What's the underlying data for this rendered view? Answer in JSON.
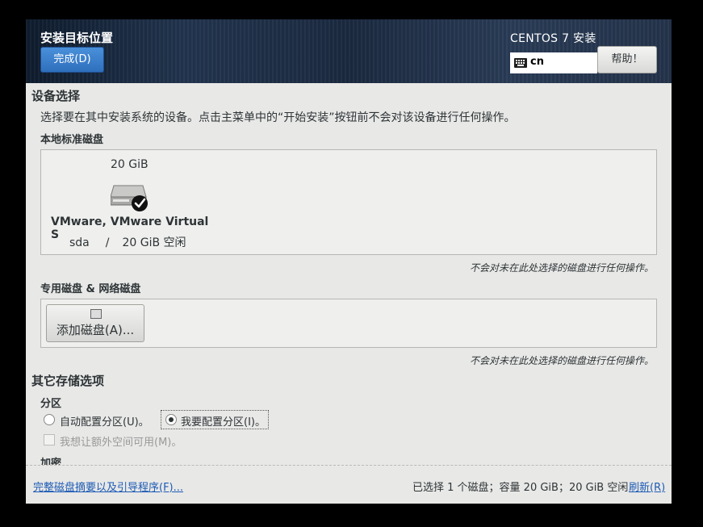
{
  "header": {
    "title": "安装目标位置",
    "done_label": "完成(D)",
    "product": "CENTOS 7 安装",
    "keyboard_layout": "cn",
    "help_label": "帮助！"
  },
  "device_selection": {
    "heading": "设备选择",
    "description": "选择要在其中安装系统的设备。点击主菜单中的“开始安装”按钮前不会对该设备进行任何操作。",
    "local_disks_heading": "本地标准磁盘",
    "disk": {
      "size": "20 GiB",
      "name": "VMware, VMware Virtual S",
      "device": "sda",
      "separator": "/",
      "free": "20 GiB 空闲",
      "selected": true
    },
    "local_note": "不会对未在此处选择的磁盘进行任何操作。",
    "specialized_heading": "专用磁盘 & 网络磁盘",
    "add_disk_label": "添加磁盘(A)...",
    "specialized_note": "不会对未在此处选择的磁盘进行任何操作。"
  },
  "other_options": {
    "heading": "其它存储选项",
    "partition_heading": "分区",
    "auto_partition": "自动配置分区(U)。",
    "manual_partition": "我要配置分区(I)。",
    "selected": "manual",
    "extra_space": "我想让额外空间可用(M)。",
    "extra_space_checked": false,
    "encryption_heading": "加密"
  },
  "footer": {
    "summary_link": "完整磁盘摘要以及引导程序(F)...",
    "status": "已选择 1 个磁盘；容量 20 GiB；20 GiB 空闲",
    "refresh_link": "刷新(R)"
  },
  "icons": {
    "keyboard": "keyboard-icon",
    "disk": "hard-disk-icon",
    "check": "check-mark-icon",
    "add_disk": "disk-add-icon"
  }
}
